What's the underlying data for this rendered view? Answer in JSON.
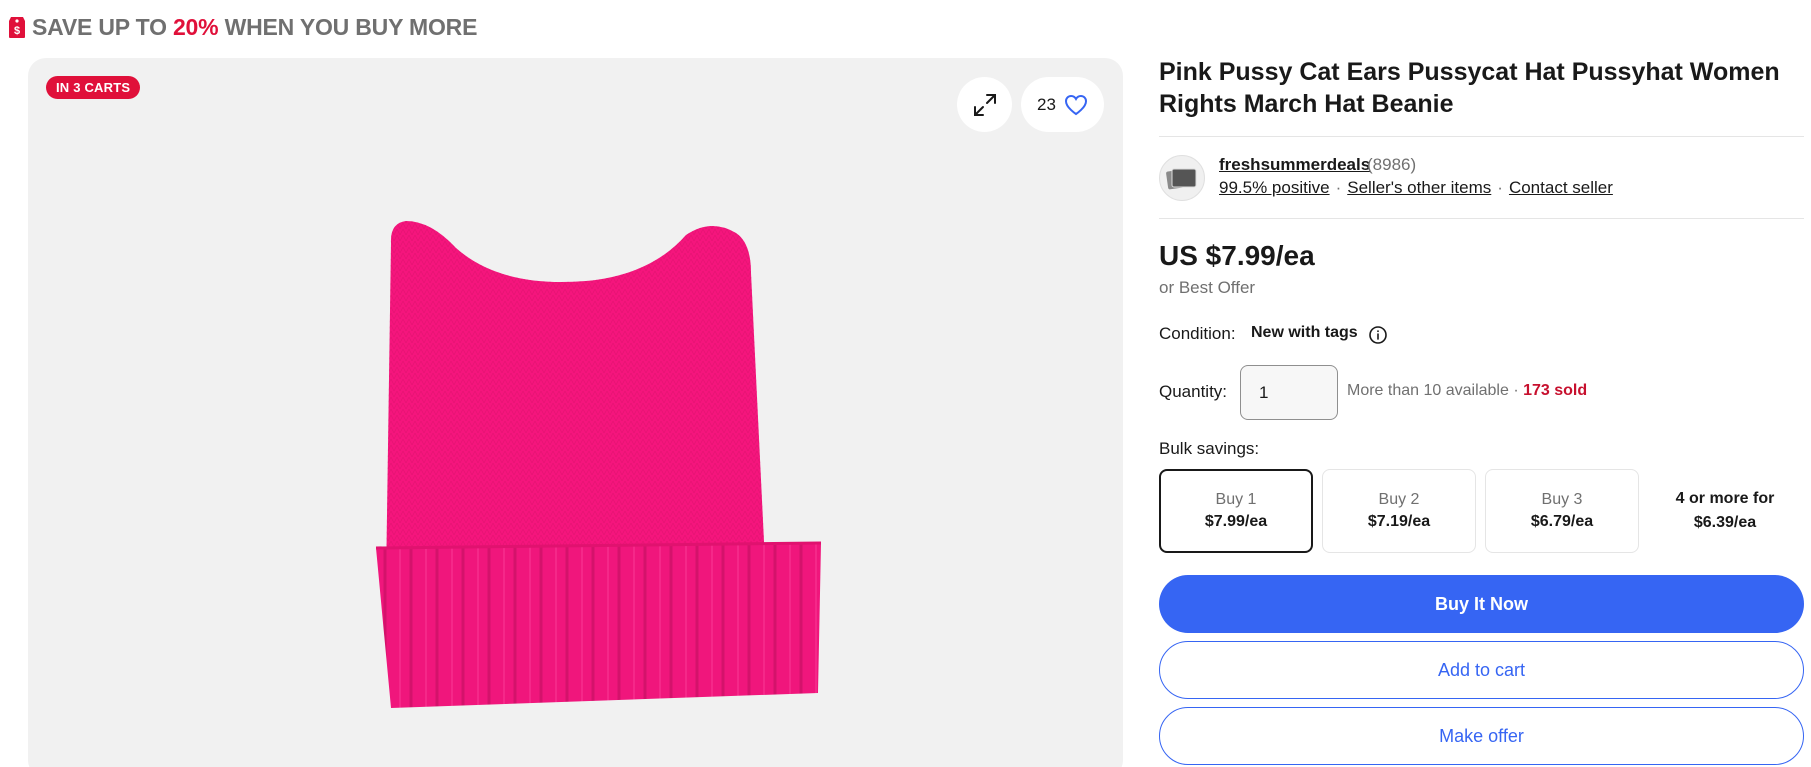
{
  "promo": {
    "prefix": "SAVE UP TO ",
    "percent": "20%",
    "suffix": " WHEN YOU BUY MORE",
    "icon": "price-tag-icon"
  },
  "gallery": {
    "badge": "IN 3 CARTS",
    "watch_count": "23",
    "icons": [
      "expand-icon",
      "heart-icon"
    ]
  },
  "product": {
    "title": "Pink Pussy Cat Ears Pussycat Hat Pussyhat Women Rights March Hat Beanie",
    "price": "US $7.99/ea",
    "best_offer": "or Best Offer"
  },
  "seller": {
    "name": "freshsummerdeals",
    "feedback_count": "(8986)",
    "positive": "99.5% positive",
    "other_items": "Seller's other items",
    "contact": "Contact seller",
    "separator": "·"
  },
  "condition": {
    "label": "Condition:",
    "value": "New with tags"
  },
  "quantity": {
    "label": "Quantity:",
    "value": "1",
    "available": "More than 10 available",
    "separator": " · ",
    "sold": "173 sold"
  },
  "bulk": {
    "label": "Bulk savings:",
    "tiers": [
      {
        "label": "Buy 1",
        "price": "$7.99/ea",
        "selected": true
      },
      {
        "label": "Buy 2",
        "price": "$7.19/ea",
        "selected": false
      },
      {
        "label": "Buy 3",
        "price": "$6.79/ea",
        "selected": false
      },
      {
        "label": "4 or more for",
        "price": "$6.39/ea",
        "selected": false
      }
    ]
  },
  "actions": {
    "buy_now": "Buy It Now",
    "add_to_cart": "Add to cart",
    "make_offer": "Make offer"
  },
  "colors": {
    "accent_blue": "#3665f3",
    "sale_red": "#e0103a",
    "product_pink": "#f5157d"
  }
}
